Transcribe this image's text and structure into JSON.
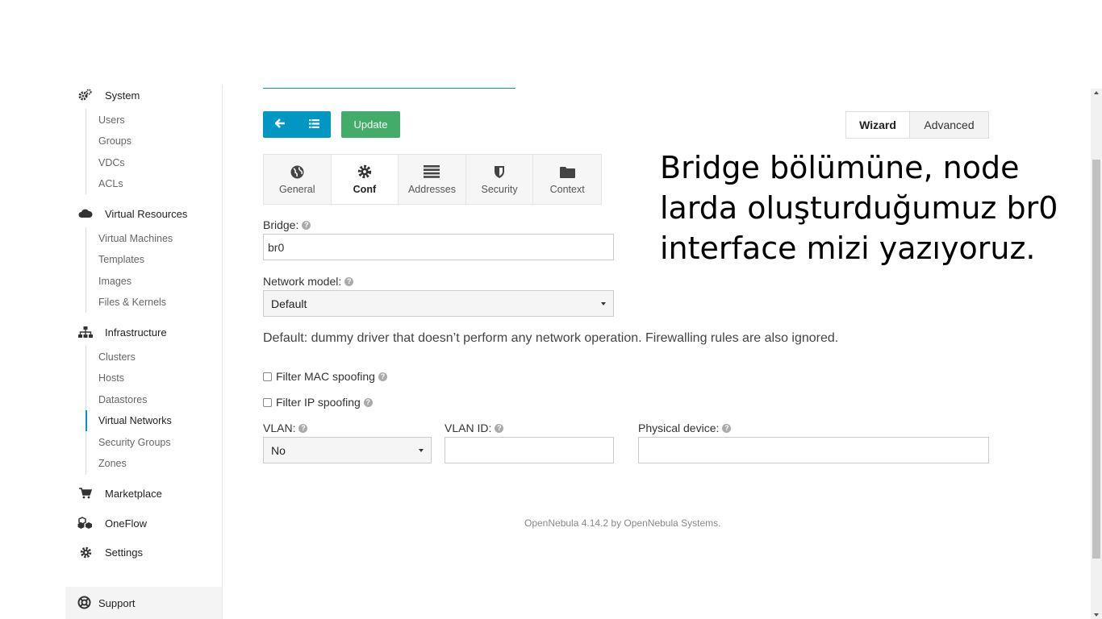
{
  "sidebar": {
    "sections": [
      {
        "label": "System",
        "icon": "gears-icon",
        "items": [
          "Users",
          "Groups",
          "VDCs",
          "ACLs"
        ]
      },
      {
        "label": "Virtual Resources",
        "icon": "cloud-icon",
        "items": [
          "Virtual Machines",
          "Templates",
          "Images",
          "Files & Kernels"
        ]
      },
      {
        "label": "Infrastructure",
        "icon": "sitemap-icon",
        "items": [
          "Clusters",
          "Hosts",
          "Datastores",
          "Virtual Networks",
          "Security Groups",
          "Zones"
        ]
      },
      {
        "label": "Marketplace",
        "icon": "shopping-cart-icon"
      },
      {
        "label": "OneFlow",
        "icon": "cubes-icon"
      },
      {
        "label": "Settings",
        "icon": "gear-icon"
      }
    ],
    "active_item": "Virtual Networks",
    "support_label": "Support"
  },
  "toolbar": {
    "update_label": "Update",
    "mode_tabs": [
      "Wizard",
      "Advanced"
    ],
    "active_mode": "Wizard"
  },
  "tabs": [
    {
      "label": "General",
      "icon": "globe-icon"
    },
    {
      "label": "Conf",
      "icon": "gear-icon"
    },
    {
      "label": "Addresses",
      "icon": "list-icon"
    },
    {
      "label": "Security",
      "icon": "shield-icon"
    },
    {
      "label": "Context",
      "icon": "folder-icon"
    }
  ],
  "active_tab": "Conf",
  "form": {
    "bridge_label": "Bridge:",
    "bridge_value": "br0",
    "network_model_label": "Network model:",
    "network_model_value": "Default",
    "network_model_desc": "Default: dummy driver that doesn’t perform any network operation. Firewalling rules are also ignored.",
    "filter_mac_label": "Filter MAC spoofing",
    "filter_ip_label": "Filter IP spoofing",
    "vlan_label": "VLAN:",
    "vlan_value": "No",
    "vlan_id_label": "VLAN ID:",
    "vlan_id_value": "",
    "physical_device_label": "Physical device:",
    "physical_device_value": ""
  },
  "footer": "OpenNebula 4.14.2 by OpenNebula Systems.",
  "annotation": "Bridge bölümüne, node larda oluşturduğumuz br0 interface mizi yazıyoruz.",
  "colors": {
    "accent": "#0098c3",
    "update": "#43ac6a"
  }
}
